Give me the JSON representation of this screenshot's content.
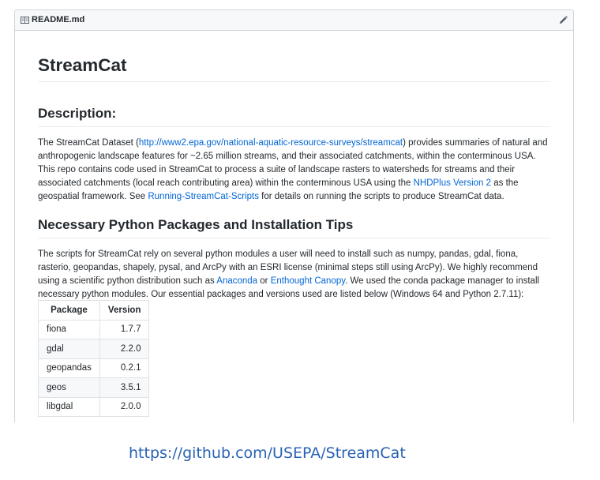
{
  "header": {
    "filename": "README.md"
  },
  "title": "StreamCat",
  "description": {
    "heading": "Description:",
    "t1": "The StreamCat Dataset (",
    "link1": "http://www2.epa.gov/national-aquatic-resource-surveys/streamcat",
    "t2": ") provides summaries of natural and anthropogenic landscape features for ~2.65 million streams, and their associated catchments, within the conterminous USA. This repo contains code used in StreamCat to process a suite of landscape rasters to watersheds for streams and their associated catchments (local reach contributing area) within the conterminous USA using the ",
    "link2": "NHDPlus Version 2",
    "t3": " as the geospatial framework. See ",
    "link3": "Running-StreamCat-Scripts",
    "t4": " for details on running the scripts to produce StreamCat data."
  },
  "packages": {
    "heading": "Necessary Python Packages and Installation Tips",
    "t1": "The scripts for StreamCat rely on several python modules a user will need to install such as numpy, pandas, gdal, fiona, rasterio, geopandas, shapely, pysal, and ArcPy with an ESRI license (minimal steps still using ArcPy). We highly recommend using a scientific python distribution such as ",
    "link1": "Anaconda",
    "t2": " or ",
    "link2": "Enthought Canopy",
    "t3": ". We used the conda package manager to install necessary python modules. Our essential packages and versions used are listed below (Windows 64 and Python 2.7.11):"
  },
  "table": {
    "headers": [
      "Package",
      "Version"
    ],
    "rows": [
      [
        "fiona",
        "1.7.7"
      ],
      [
        "gdal",
        "2.2.0"
      ],
      [
        "geopandas",
        "0.2.1"
      ],
      [
        "geos",
        "3.5.1"
      ],
      [
        "libgdal",
        "2.0.0"
      ]
    ]
  },
  "footer_url": "https://github.com/USEPA/StreamCat",
  "icons": [
    "book-icon",
    "pencil-icon"
  ],
  "colors": {
    "link": "#0366d6",
    "footer_link": "#2a63b5",
    "header_bg": "#f6f8fa"
  }
}
